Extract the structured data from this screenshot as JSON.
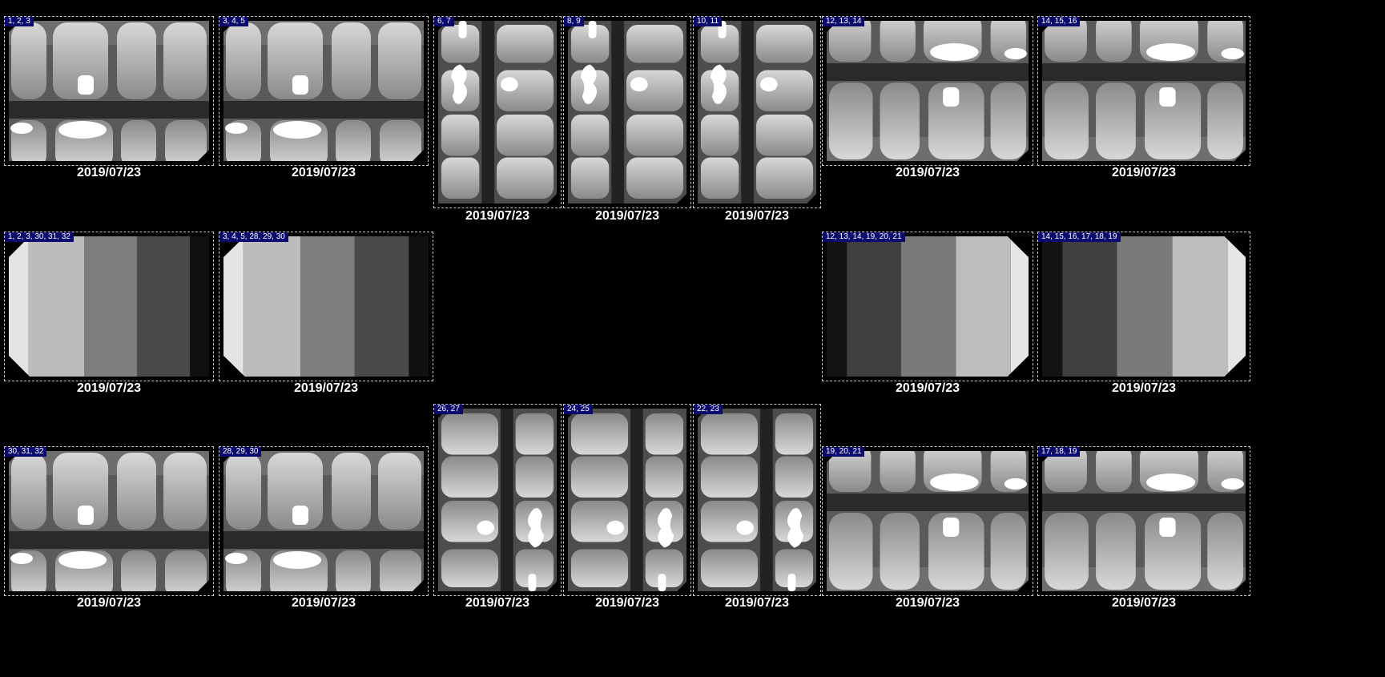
{
  "viewer": {
    "slots": [
      {
        "teeth": "1, 2, 3",
        "date": "2019/07/23",
        "kind": "bitewing-top"
      },
      {
        "teeth": "3, 4, 5",
        "date": "2019/07/23",
        "kind": "bitewing-top"
      },
      {
        "teeth": "6, 7",
        "date": "2019/07/23",
        "kind": "anterior-top"
      },
      {
        "teeth": "8, 9",
        "date": "2019/07/23",
        "kind": "anterior-top"
      },
      {
        "teeth": "10, 11",
        "date": "2019/07/23",
        "kind": "anterior-top"
      },
      {
        "teeth": "12, 13, 14",
        "date": "2019/07/23",
        "kind": "bitewing-bottom"
      },
      {
        "teeth": "14, 15, 16",
        "date": "2019/07/23",
        "kind": "bitewing-bottom"
      },
      {
        "teeth": "1, 2, 3, 30, 31, 32",
        "date": "2019/07/23",
        "kind": "blank-left"
      },
      {
        "teeth": "3, 4, 5, 28, 29, 30",
        "date": "2019/07/23",
        "kind": "blank-left"
      },
      {
        "teeth": "12, 13, 14, 19, 20, 21",
        "date": "2019/07/23",
        "kind": "blank-right"
      },
      {
        "teeth": "14, 15, 16, 17, 18, 19",
        "date": "2019/07/23",
        "kind": "blank-right"
      },
      {
        "teeth": "30, 31, 32",
        "date": "2019/07/23",
        "kind": "bitewing-top"
      },
      {
        "teeth": "28, 29, 30",
        "date": "2019/07/23",
        "kind": "bitewing-top"
      },
      {
        "teeth": "26, 27",
        "date": "2019/07/23",
        "kind": "anterior-bottom"
      },
      {
        "teeth": "24, 25",
        "date": "2019/07/23",
        "kind": "anterior-bottom"
      },
      {
        "teeth": "22, 23",
        "date": "2019/07/23",
        "kind": "anterior-bottom"
      },
      {
        "teeth": "19, 20, 21",
        "date": "2019/07/23",
        "kind": "bitewing-bottom"
      },
      {
        "teeth": "17, 18, 19",
        "date": "2019/07/23",
        "kind": "bitewing-bottom"
      }
    ]
  }
}
